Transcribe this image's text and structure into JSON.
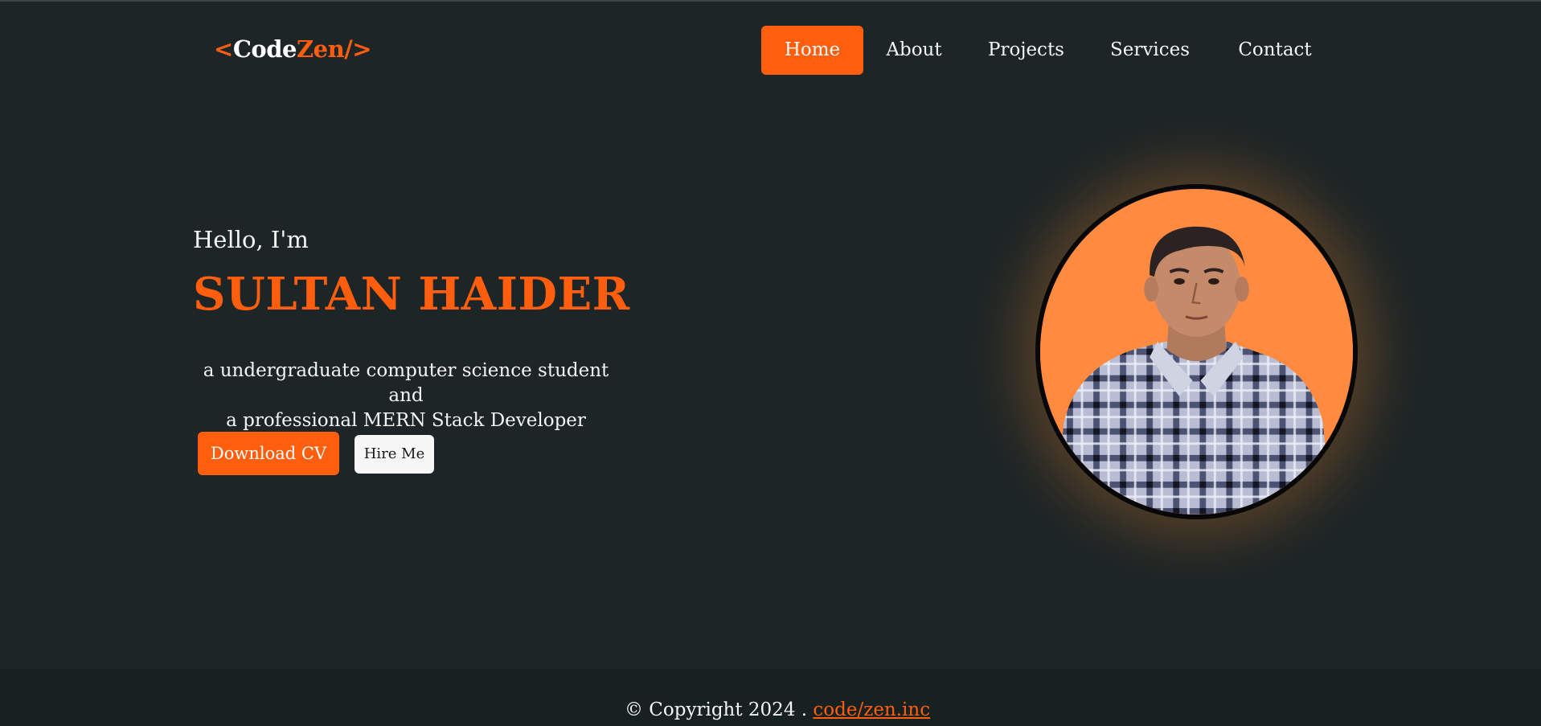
{
  "logo": {
    "lt": "<",
    "code": "Code",
    "zen": "Zen",
    "close": "/>"
  },
  "nav": {
    "home": "Home",
    "about": "About",
    "projects": "Projects",
    "services": "Services",
    "contact": "Contact"
  },
  "hero": {
    "greeting": "Hello, I'm",
    "name": "SULTAN HAIDER",
    "tagline_line1": "a undergraduate computer science student and",
    "tagline_line2": "a professional MERN Stack Developer",
    "download_cv": "Download CV",
    "hire_me": "Hire Me"
  },
  "footer": {
    "copyright": "© Copyright 2024 . ",
    "brand_link": "code/zen.inc"
  },
  "colors": {
    "accent": "#ff5e0e",
    "background": "#1d2526",
    "footer_bg": "#182122",
    "avatar_bg": "#ff8a40"
  },
  "icons": [
    "profile-photo"
  ]
}
